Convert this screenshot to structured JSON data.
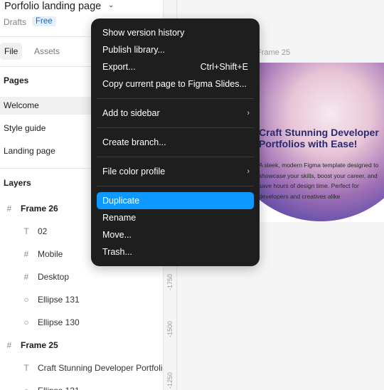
{
  "file": {
    "title": "Porfolio landing page",
    "location": "Drafts",
    "plan": "Free"
  },
  "tabs": [
    {
      "label": "File"
    },
    {
      "label": "Assets"
    }
  ],
  "pages": {
    "title": "Pages",
    "items": [
      {
        "label": "Welcome"
      },
      {
        "label": "Style guide"
      },
      {
        "label": "Landing page"
      }
    ]
  },
  "layers": {
    "title": "Layers",
    "items": [
      {
        "label": "Frame 26",
        "icon": "#"
      },
      {
        "label": "02",
        "icon": "T"
      },
      {
        "label": "Mobile",
        "icon": "#"
      },
      {
        "label": "Desktop",
        "icon": "#"
      },
      {
        "label": "Ellipse 131",
        "icon": "○"
      },
      {
        "label": "Ellipse 130",
        "icon": "○"
      },
      {
        "label": "Frame 25",
        "icon": "#"
      },
      {
        "label": "Craft Stunning Developer Portfolios with Ease!",
        "icon": "T"
      },
      {
        "label": "Ellipse 131",
        "icon": "○"
      }
    ]
  },
  "canvas": {
    "ruler_labels": [
      "-1750",
      "-1500",
      "-1250"
    ],
    "frame_label": "Frame 25",
    "frame_heading": "Craft Stunning Developer Portfolios with Ease!",
    "frame_body": "A sleek, modern Figma template designed to showcase your skills, boost your career, and save hours of design time. Perfect for developers and creatives alike"
  },
  "menu": {
    "items": [
      {
        "label": "Show version history"
      },
      {
        "label": "Publish library..."
      },
      {
        "label": "Export...",
        "shortcut": "Ctrl+Shift+E"
      },
      {
        "label": "Copy current page to Figma Slides..."
      },
      {
        "label": "Add to sidebar",
        "submenu": true
      },
      {
        "label": "Create branch..."
      },
      {
        "label": "File color profile",
        "submenu": true
      },
      {
        "label": "Duplicate",
        "highlighted": true
      },
      {
        "label": "Rename"
      },
      {
        "label": "Move..."
      },
      {
        "label": "Trash..."
      }
    ]
  },
  "colors": {
    "menu_bg": "#1e1e1e",
    "highlight": "#0d99ff",
    "badge_text": "#0d66d0"
  }
}
